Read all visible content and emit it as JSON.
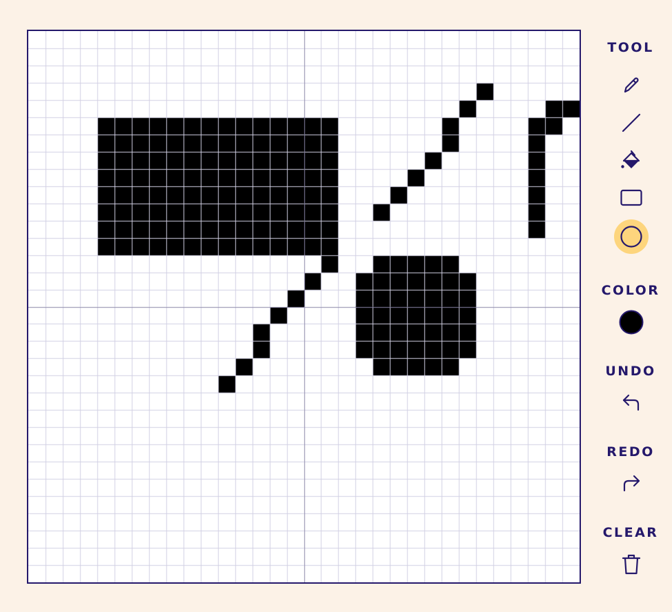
{
  "toolbar": {
    "tool_label": "TOOL",
    "color_label": "COLOR",
    "undo_label": "UNDO",
    "redo_label": "REDO",
    "clear_label": "CLEAR",
    "tools": [
      {
        "name": "pencil",
        "icon": "pencil-icon",
        "active": false
      },
      {
        "name": "line",
        "icon": "line-icon",
        "active": false
      },
      {
        "name": "fill",
        "icon": "paint-bucket-icon",
        "active": false
      },
      {
        "name": "rectangle",
        "icon": "rectangle-icon",
        "active": false
      },
      {
        "name": "circle",
        "icon": "circle-icon",
        "active": true
      }
    ],
    "active_tool": "circle",
    "current_color": "#000000",
    "undo_icon": "undo-icon",
    "redo_icon": "redo-icon",
    "clear_icon": "trash-icon"
  },
  "canvas": {
    "grid_cells": 32,
    "background_color": "#ffffff",
    "grid_color": "#d2d1e4",
    "axis_color": "#8a86a8",
    "border_color": "#24186b",
    "pixel_color": "#000000",
    "filled_rows": [
      "..........................#.....",
      ".........................#....##",
      "....##############......#....##.",
      "....##############......#....#..",
      "....##############.....#.....#..",
      "....##############....#......#..",
      "....##############...#.......#..",
      "....##############..#........#..",
      "....##############...........#..",
      "....##############..............",
      ".................#..#####.......",
      "................#..#######......",
      "...............#...#######......",
      "..............#....#######......",
      ".............#.....#######......",
      ".............#.....#######......",
      "............#.......#####.......",
      "...........#...................."
    ],
    "filled_rows_start": 3
  }
}
